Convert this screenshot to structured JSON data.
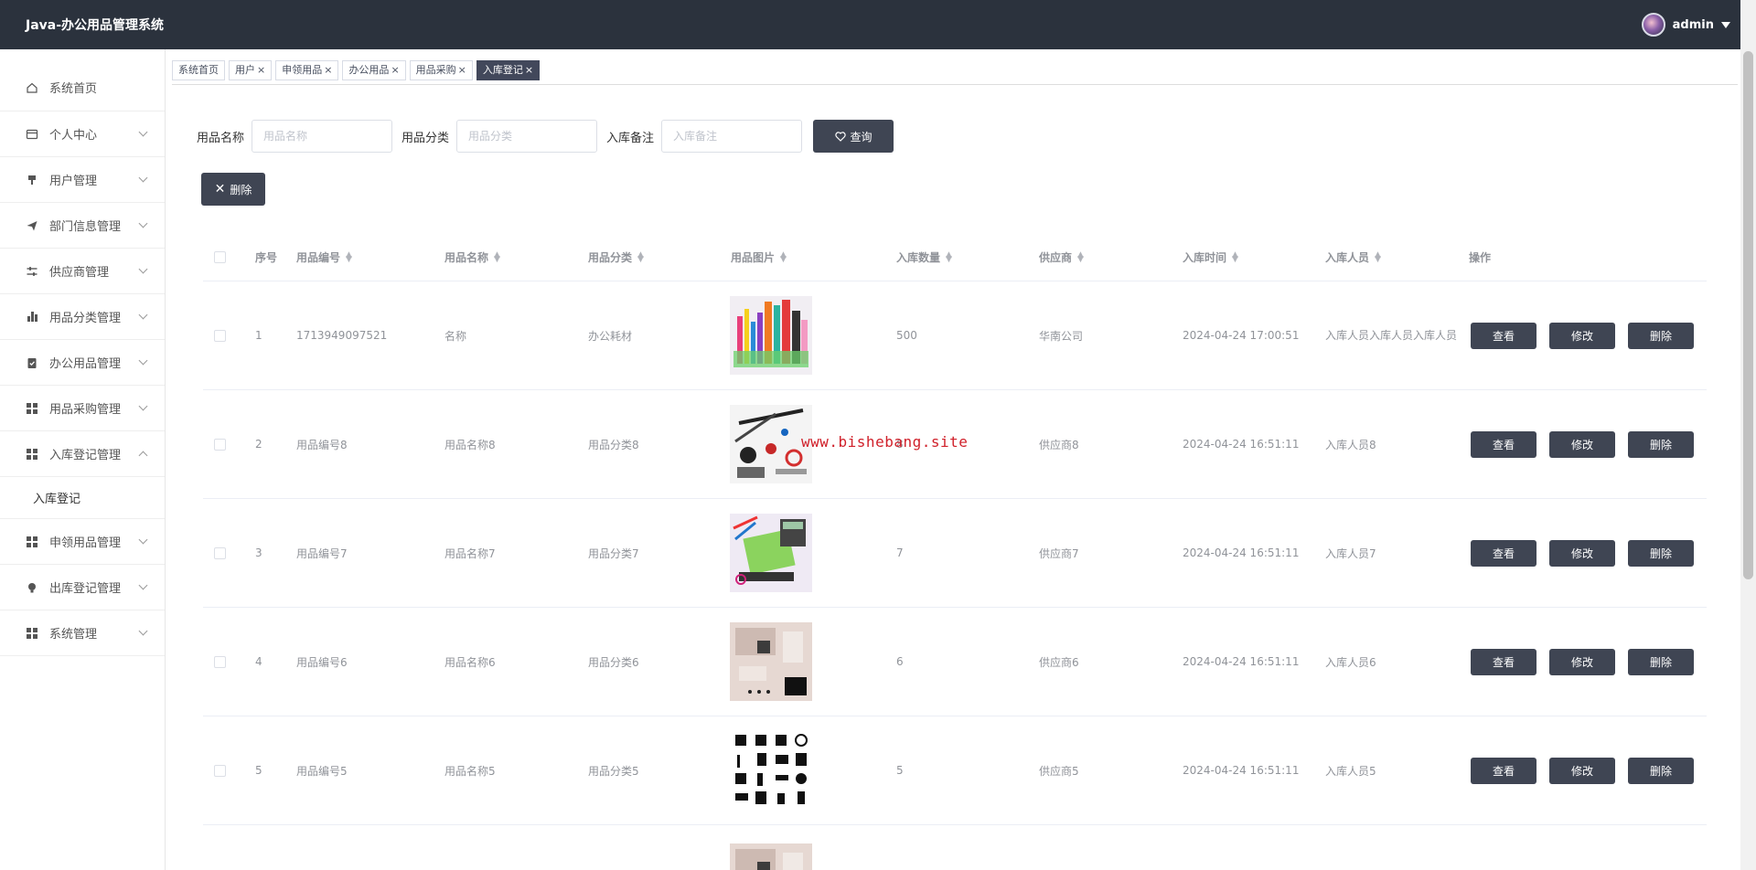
{
  "app": {
    "title": "Java-办公用品管理系统",
    "user": "admin"
  },
  "sidebar": {
    "items": [
      {
        "label": "系统首页",
        "icon": "home-icon"
      },
      {
        "label": "个人中心",
        "icon": "card-icon"
      },
      {
        "label": "用户管理",
        "icon": "stamp-icon"
      },
      {
        "label": "部门信息管理",
        "icon": "send-icon"
      },
      {
        "label": "供应商管理",
        "icon": "sliders-icon"
      },
      {
        "label": "用品分类管理",
        "icon": "bar-chart-icon"
      },
      {
        "label": "办公用品管理",
        "icon": "clipboard-icon"
      },
      {
        "label": "用品采购管理",
        "icon": "grid-icon"
      },
      {
        "label": "入库登记管理",
        "icon": "grid-icon"
      },
      {
        "label": "申领用品管理",
        "icon": "grid-icon"
      },
      {
        "label": "出库登记管理",
        "icon": "bulb-icon"
      },
      {
        "label": "系统管理",
        "icon": "grid-icon"
      }
    ],
    "submenu": {
      "label": "入库登记"
    }
  },
  "tabs": [
    {
      "label": "系统首页",
      "closable": false
    },
    {
      "label": "用户",
      "closable": true
    },
    {
      "label": "申领用品",
      "closable": true
    },
    {
      "label": "办公用品",
      "closable": true
    },
    {
      "label": "用品采购",
      "closable": true
    },
    {
      "label": "入库登记",
      "closable": true,
      "active": true
    }
  ],
  "search": {
    "name_label": "用品名称",
    "name_placeholder": "用品名称",
    "category_label": "用品分类",
    "category_placeholder": "用品分类",
    "remark_label": "入库备注",
    "remark_placeholder": "入库备注",
    "query_label": "查询"
  },
  "toolbar": {
    "delete_label": "删除"
  },
  "table": {
    "headers": [
      "序号",
      "用品编号",
      "用品名称",
      "用品分类",
      "用品图片",
      "入库数量",
      "供应商",
      "入库时间",
      "入库人员",
      "操作"
    ],
    "rows": [
      {
        "index": "1",
        "code": "1713949097521",
        "name": "名称",
        "category": "办公耗材",
        "qty": "500",
        "supplier": "华南公司",
        "time": "2024-04-24 17:00:51",
        "person": "入库人员入库人员入库人员"
      },
      {
        "index": "2",
        "code": "用品编号8",
        "name": "用品名称8",
        "category": "用品分类8",
        "qty": "8",
        "supplier": "供应商8",
        "time": "2024-04-24 16:51:11",
        "person": "入库人员8"
      },
      {
        "index": "3",
        "code": "用品编号7",
        "name": "用品名称7",
        "category": "用品分类7",
        "qty": "7",
        "supplier": "供应商7",
        "time": "2024-04-24 16:51:11",
        "person": "入库人员7"
      },
      {
        "index": "4",
        "code": "用品编号6",
        "name": "用品名称6",
        "category": "用品分类6",
        "qty": "6",
        "supplier": "供应商6",
        "time": "2024-04-24 16:51:11",
        "person": "入库人员6"
      },
      {
        "index": "5",
        "code": "用品编号5",
        "name": "用品名称5",
        "category": "用品分类5",
        "qty": "5",
        "supplier": "供应商5",
        "time": "2024-04-24 16:51:11",
        "person": "入库人员5"
      }
    ],
    "actions": {
      "view": "查看",
      "edit": "修改",
      "delete": "删除"
    }
  },
  "watermark": "www.bishebang.site"
}
